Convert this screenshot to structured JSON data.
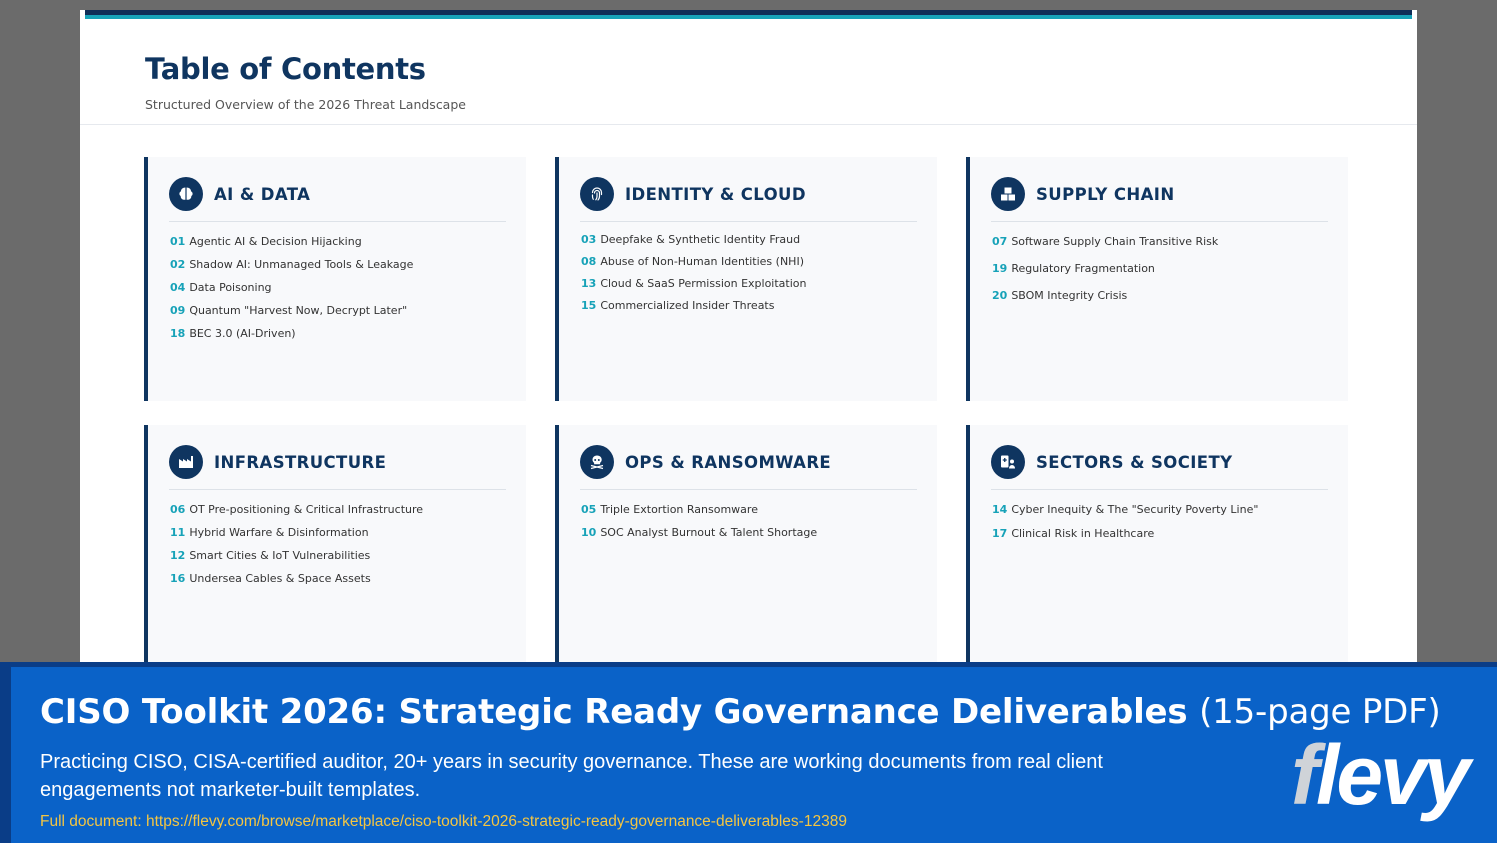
{
  "page": {
    "title": "Table of Contents",
    "subtitle": "Structured Overview of the 2026 Threat Landscape"
  },
  "sections": [
    {
      "title": "AI & DATA",
      "icon": "brain-icon",
      "items": [
        {
          "num": "01",
          "text": "Agentic AI & Decision Hijacking"
        },
        {
          "num": "02",
          "text": "Shadow AI: Unmanaged Tools & Leakage"
        },
        {
          "num": "04",
          "text": "Data Poisoning"
        },
        {
          "num": "09",
          "text": "Quantum \"Harvest Now, Decrypt Later\""
        },
        {
          "num": "18",
          "text": "BEC 3.0 (AI-Driven)"
        }
      ]
    },
    {
      "title": "IDENTITY & CLOUD",
      "icon": "fingerprint-icon",
      "items": [
        {
          "num": "03",
          "text": "Deepfake & Synthetic Identity Fraud"
        },
        {
          "num": "08",
          "text": "Abuse of Non-Human Identities (NHI)"
        },
        {
          "num": "13",
          "text": "Cloud & SaaS Permission Exploitation"
        },
        {
          "num": "15",
          "text": "Commercialized Insider Threats"
        }
      ]
    },
    {
      "title": "SUPPLY CHAIN",
      "icon": "boxes-icon",
      "items": [
        {
          "num": "07",
          "text": "Software Supply Chain Transitive Risk"
        },
        {
          "num": "19",
          "text": "Regulatory Fragmentation"
        },
        {
          "num": "20",
          "text": "SBOM Integrity Crisis"
        }
      ]
    },
    {
      "title": "INFRASTRUCTURE",
      "icon": "factory-icon",
      "items": [
        {
          "num": "06",
          "text": "OT Pre-positioning & Critical Infrastructure"
        },
        {
          "num": "11",
          "text": "Hybrid Warfare & Disinformation"
        },
        {
          "num": "12",
          "text": "Smart Cities & IoT Vulnerabilities"
        },
        {
          "num": "16",
          "text": "Undersea Cables & Space Assets"
        }
      ]
    },
    {
      "title": "OPS & RANSOMWARE",
      "icon": "skull-icon",
      "items": [
        {
          "num": "05",
          "text": "Triple Extortion Ransomware"
        },
        {
          "num": "10",
          "text": "SOC Analyst Burnout & Talent Shortage"
        }
      ]
    },
    {
      "title": "SECTORS & SOCIETY",
      "icon": "hospital-user-icon",
      "items": [
        {
          "num": "14",
          "text": "Cyber Inequity & The \"Security Poverty Line\""
        },
        {
          "num": "17",
          "text": "Clinical Risk in Healthcare"
        }
      ]
    }
  ],
  "banner": {
    "title": "CISO Toolkit 2026: Strategic Ready Governance Deliverables",
    "title_suffix": "(15-page PDF)",
    "description": "Practicing CISO, CISA-certified auditor, 20+ years in security governance. These are working documents from real client engagements not marketer-built templates.",
    "link": "Full document: https://flevy.com/browse/marketplace/ciso-toolkit-2026-strategic-ready-governance-deliverables-12389",
    "logo": "flevy"
  },
  "colors": {
    "navy": "#0f3560",
    "teal": "#17a2b8",
    "banner": "#0a62c8",
    "link": "#f4c542"
  }
}
